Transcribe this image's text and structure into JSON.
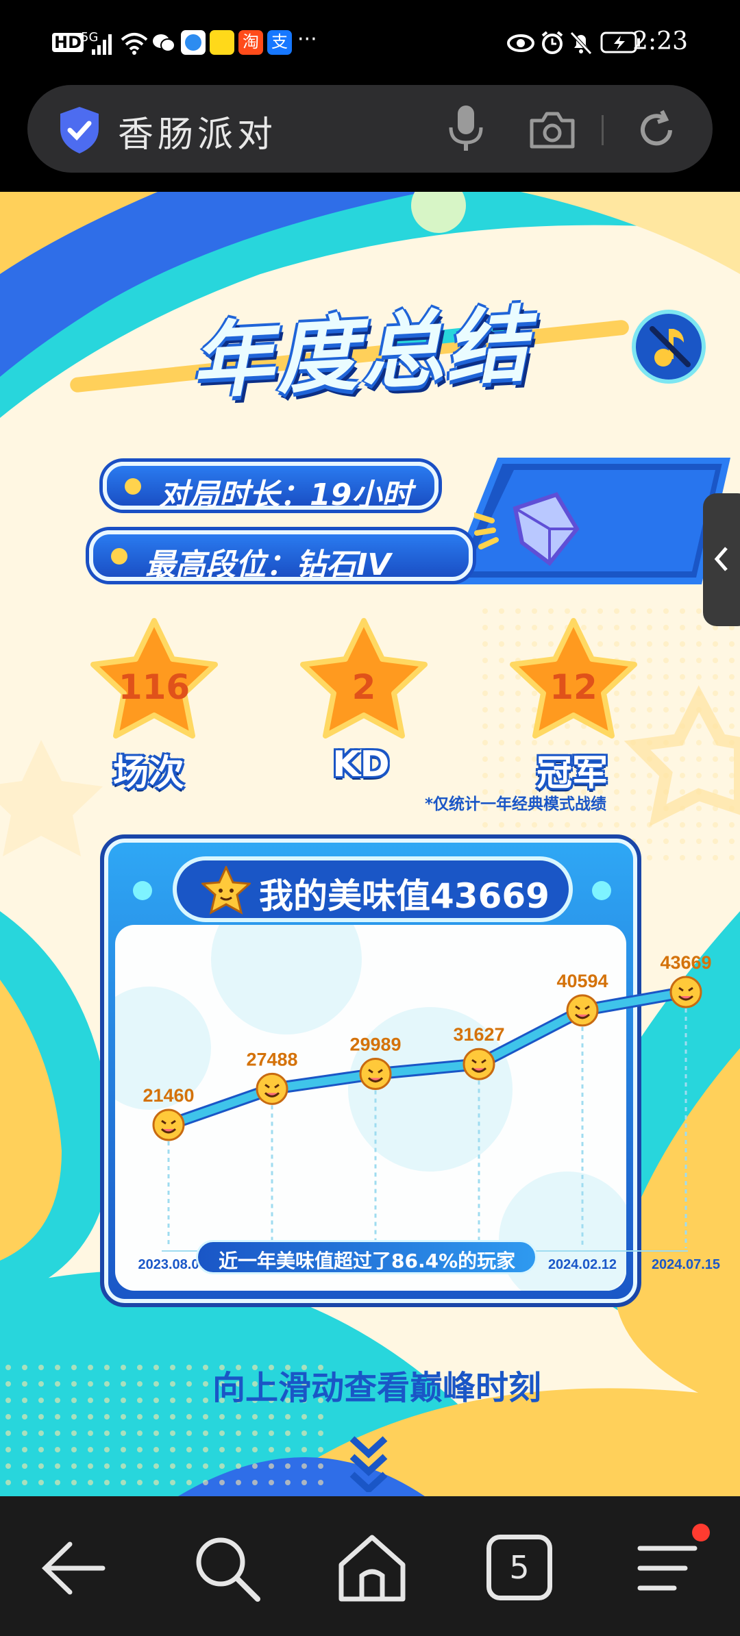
{
  "status_bar": {
    "hd": "HD",
    "network": "5G",
    "more": "···",
    "time": "2:23"
  },
  "search": {
    "query": "香肠派对"
  },
  "page": {
    "title": "年度总结",
    "stats": {
      "duration_label": "对局时长：19小时",
      "rank_label": "最高段位：钻石IV"
    },
    "stars": [
      {
        "value": "116",
        "label": "场次"
      },
      {
        "value": "2",
        "label": "KD"
      },
      {
        "value": "12",
        "label": "冠军"
      }
    ],
    "footnote": "*仅统计一年经典模式战绩",
    "score_title": "我的美味值43669",
    "percentile_note": "近一年美味值超过了86.4%的玩家",
    "scroll_hint": "向上滑动查看巅峰时刻"
  },
  "chart_data": {
    "type": "line",
    "title": "我的美味值43669",
    "x": [
      "2023.08.0",
      "",
      "",
      "",
      "2024.02.12",
      "2024.07.15"
    ],
    "values": [
      21460,
      27488,
      29989,
      31627,
      40594,
      43669
    ],
    "point_labels": [
      "21460",
      "27488",
      "29989",
      "31627",
      "40594",
      "43669"
    ],
    "xlabel": "",
    "ylabel": "",
    "grid": false,
    "colors": {
      "line": "#3fc4ea",
      "label": "#d4720a"
    }
  },
  "nav": {
    "tabs_count": "5"
  },
  "colors": {
    "brand_blue": "#1a56c6",
    "accent_cyan": "#2fd7dc",
    "accent_yellow": "#ffd25a",
    "star_orange": "#ff9a1f"
  }
}
